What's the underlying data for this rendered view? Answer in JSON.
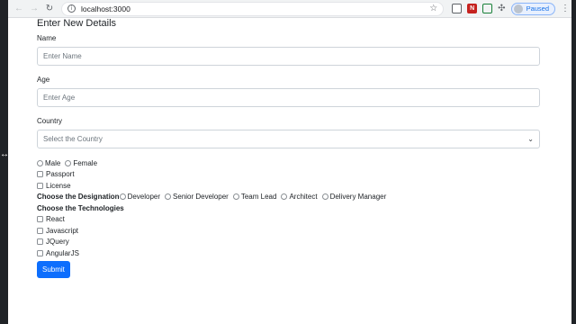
{
  "browser": {
    "url": "localhost:3000",
    "paused_label": "Paused"
  },
  "form": {
    "heading": "Enter New Details",
    "name_label": "Name",
    "name_placeholder": "Enter Name",
    "age_label": "Age",
    "age_placeholder": "Enter Age",
    "country_label": "Country",
    "country_selected": "Select the Country",
    "gender_options": [
      "Male",
      "Female"
    ],
    "documents": [
      "Passport",
      "License"
    ],
    "designation_label": "Choose the Designation",
    "designations": [
      "Developer",
      "Senior Developer",
      "Team Lead",
      "Architect",
      "Delivery Manager"
    ],
    "technologies_label": "Choose the Technologies",
    "technologies": [
      "React",
      "Javascript",
      "JQuery",
      "AngularJS"
    ],
    "submit_label": "Submit"
  }
}
